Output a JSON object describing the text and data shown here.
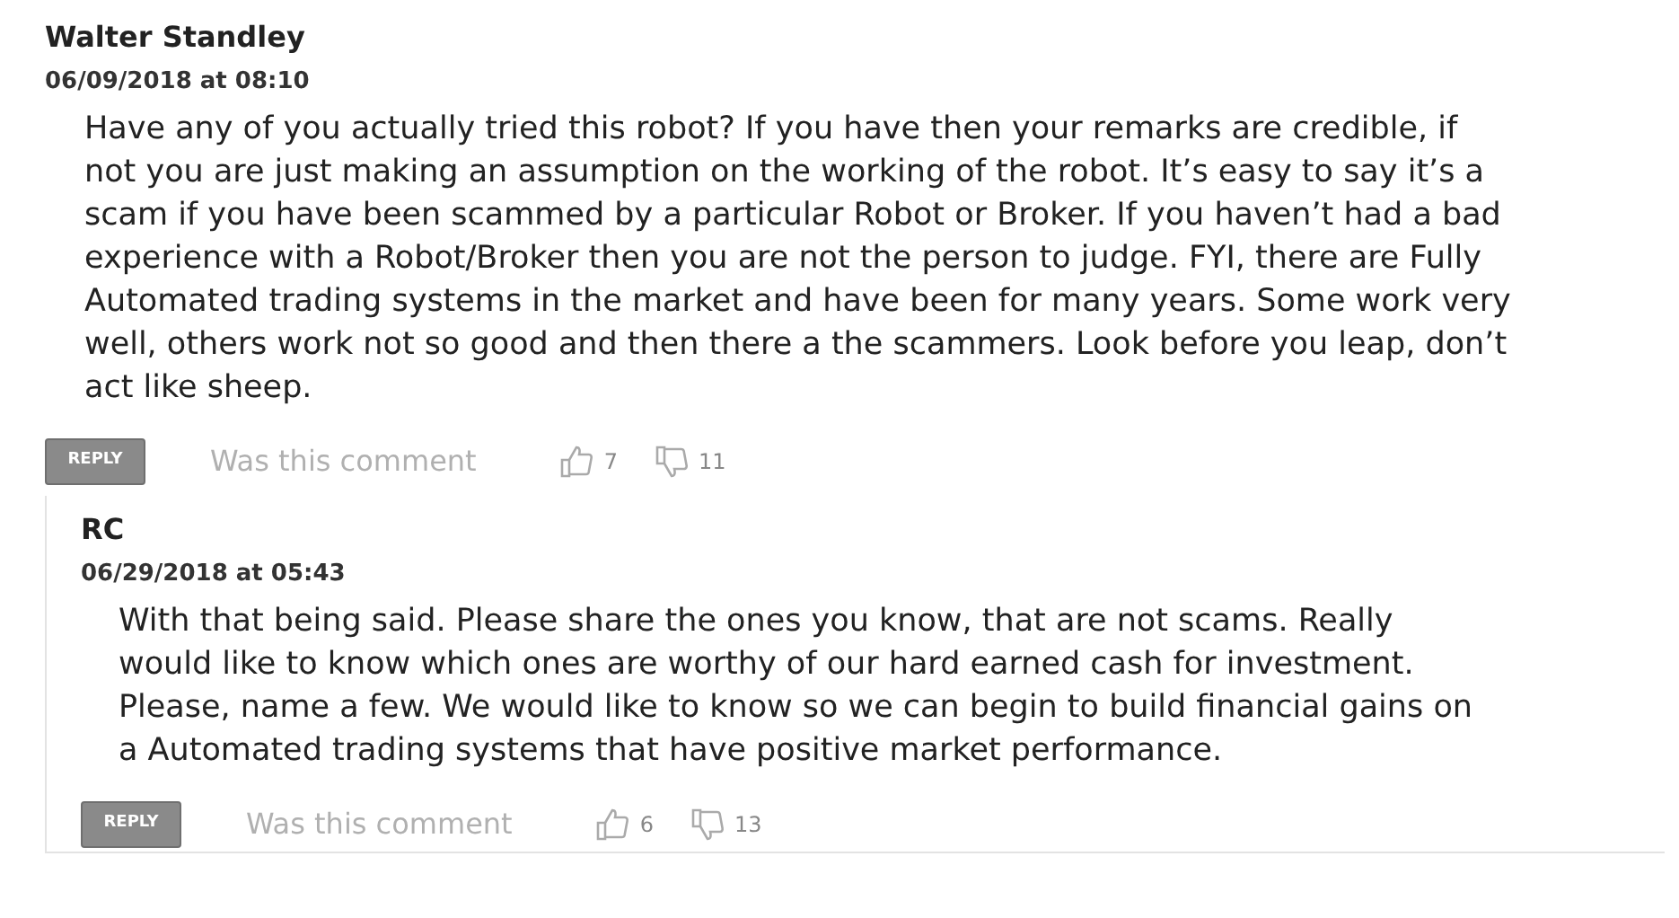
{
  "comments": [
    {
      "author": "Walter Standley",
      "date": "06/09/2018 at 08:10",
      "body_lines": [
        "Have any of you actually tried this robot? If you have then your remarks are credible, if",
        "not you are just making an assumption on the working of the robot. It’s easy to say it’s a",
        "scam if you have been scammed by a particular Robot or Broker. If you haven’t had a bad",
        "experience with a Robot/Broker then you are not the person to judge. FYI, there are Fully",
        "Automated trading systems in the market and have been for many years. Some work very",
        "well, others work not so good and then there a the scammers. Look before you leap, don’t",
        "act like sheep."
      ],
      "reply_button": "REPLY",
      "feedback_prompt": "Was this comment",
      "likes": "7",
      "dislikes": "11",
      "nested": false
    },
    {
      "author": "RC",
      "date": "06/29/2018 at 05:43",
      "body_lines": [
        "With that being said. Please share the ones you know, that are not scams. Really",
        "would like to know which ones are worthy of our hard earned cash for investment.",
        "Please, name a few. We would like to know so we can begin to build financial gains on",
        "a Automated trading systems that have positive market performance."
      ],
      "reply_button": "REPLY",
      "feedback_prompt": "Was this comment",
      "likes": "6",
      "dislikes": "13",
      "nested": true
    }
  ]
}
